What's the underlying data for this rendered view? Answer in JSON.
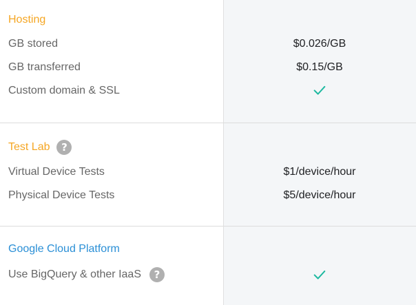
{
  "colors": {
    "section_orange": "#f5a623",
    "section_blue": "#2a8fd6",
    "check_green": "#1db9a0",
    "help_gray": "#b0b0b0"
  },
  "hosting": {
    "title": "Hosting",
    "rows": [
      {
        "label": "GB stored",
        "value": "$0.026/GB"
      },
      {
        "label": "GB transferred",
        "value": "$0.15/GB"
      },
      {
        "label": "Custom domain & SSL",
        "value_icon": "check-icon"
      }
    ]
  },
  "test_lab": {
    "title": "Test Lab",
    "title_icon": "help-icon",
    "help_glyph": "?",
    "rows": [
      {
        "label": "Virtual Device Tests",
        "value": "$1/device/hour"
      },
      {
        "label": "Physical Device Tests",
        "value": "$5/device/hour"
      }
    ]
  },
  "gcp": {
    "title": "Google Cloud Platform",
    "rows": [
      {
        "label": "Use BigQuery & other IaaS",
        "label_icon": "help-icon",
        "help_glyph": "?",
        "value_icon": "check-icon"
      }
    ]
  }
}
